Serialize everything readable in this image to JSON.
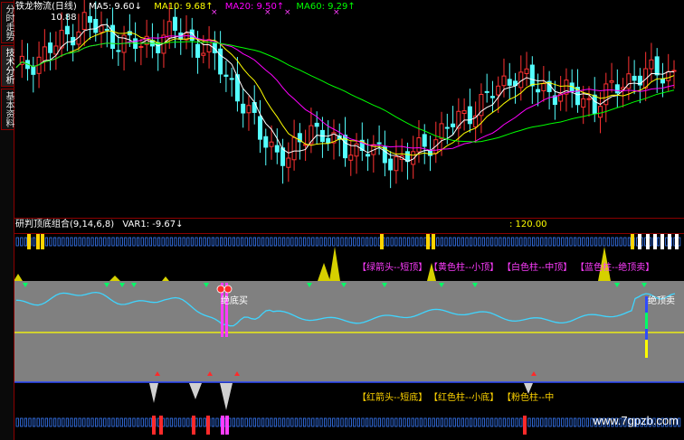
{
  "side_tabs": [
    "分时走势",
    "技术分析",
    "基本资料"
  ],
  "active_tab": 1,
  "header": {
    "title": "铁龙物流(日线)",
    "ma5": "MA5: 9.60↓",
    "ma10": "MA10: 9.68↑",
    "ma20": "MA20: 9.50↑",
    "ma60": "MA60: 9.29↑",
    "high_label": "10.88"
  },
  "indicator": {
    "name": "研判顶底组合(9,14,6,8)",
    "var1": "VAR1: -9.67↓",
    "value_label": ": 120.00",
    "mid_label": "绝底买",
    "right_label": "绝顶卖"
  },
  "legend_top": [
    {
      "text": "【绿箭头--短顶】"
    },
    {
      "text": "【黄色柱--小顶】"
    },
    {
      "text": "【白色柱--中顶】"
    },
    {
      "text": "【蓝色柱--绝顶卖】"
    }
  ],
  "legend_bottom": [
    {
      "text": "【红箭头--短底】"
    },
    {
      "text": "【红色柱--小底】"
    },
    {
      "text": "【粉色柱--中"
    }
  ],
  "watermark": "www.7gpzb.com",
  "colors": {
    "up": "#ff3232",
    "down": "#54ffff",
    "ma5": "#ffffff",
    "ma10": "#ffff00",
    "ma20": "#ff00ff",
    "ma60": "#00ff00",
    "indicator_line": "#3fd5ff",
    "panel_bg": "#808080",
    "accent_yellow": "#ffd400",
    "accent_pink": "#ff3cff"
  }
}
